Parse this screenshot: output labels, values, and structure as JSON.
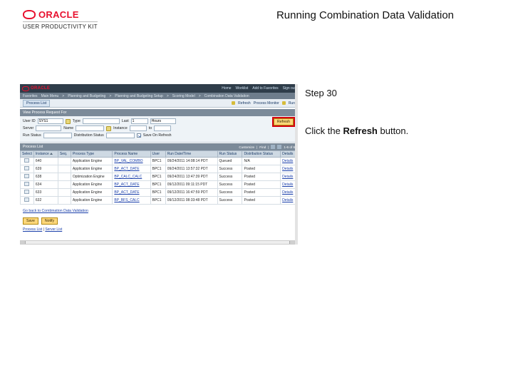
{
  "brand": {
    "name": "ORACLE",
    "product": "USER PRODUCTIVITY KIT"
  },
  "page_title": "Running Combination Data Validation",
  "step": {
    "label": "Step 30",
    "text_pre": "Click the ",
    "bold": "Refresh",
    "text_post": " button."
  },
  "app": {
    "menu": [
      "Home",
      "Worklist",
      "Add to Favorites",
      "Sign out"
    ],
    "crumbs": [
      "Favorites",
      "Main Menu",
      "Planning and Budgeting",
      "Planning and Budgeting Setup",
      "Scoring Model",
      "Combination Data Validation"
    ],
    "listhdr": {
      "tab": "Process List",
      "right": [
        "Refresh",
        "Process Monitor",
        "Run"
      ],
      "icon": "gear-icon"
    },
    "panel_title": "View Process Request For",
    "form": {
      "fields": {
        "user_id_lbl": "User ID",
        "user_id": "SYS1",
        "type_lbl": "Type",
        "type": "",
        "last_lbl": "Last",
        "last": "1",
        "last_unit": "Hours",
        "server_lbl": "Server",
        "server": "",
        "name_lbl": "Name",
        "name": "",
        "instance_lbl": "Instance",
        "instance_to": "to",
        "runstatus_lbl": "Run Status",
        "distrib_lbl": "Distribution Status",
        "savecb_lbl": "Save On Refresh"
      },
      "refresh_btn": "Refresh"
    },
    "table": {
      "cols": [
        "Select",
        "Instance",
        "Seq.",
        "Process Type",
        "Process Name",
        "User",
        "Run Date/Time",
        "Run Status",
        "Distribution Status",
        "Details"
      ],
      "rows": [
        {
          "inst": "640",
          "seq": "",
          "ptype": "Application Engine",
          "pname": "BP_VAL_COMBO",
          "user": "BPC1",
          "dt": "09/24/2011 14:08:14 PDT",
          "run": "Queued",
          "dist": "N/A",
          "det": "Details"
        },
        {
          "inst": "639",
          "seq": "",
          "ptype": "Application Engine",
          "pname": "BP_ACT_DATE",
          "user": "BPC1",
          "dt": "09/24/2011 13:57:32 PDT",
          "run": "Success",
          "dist": "Posted",
          "det": "Details"
        },
        {
          "inst": "638",
          "seq": "",
          "ptype": "Optimization Engine",
          "pname": "BP_CALC_CALC",
          "user": "BPC1",
          "dt": "09/24/2011 13:47:39 PDT",
          "run": "Success",
          "dist": "Posted",
          "det": "Details"
        },
        {
          "inst": "634",
          "seq": "",
          "ptype": "Application Engine",
          "pname": "BP_ACT_DATE",
          "user": "BPC1",
          "dt": "09/12/2011 09:11:15 PDT",
          "run": "Success",
          "dist": "Posted",
          "det": "Details"
        },
        {
          "inst": "633",
          "seq": "",
          "ptype": "Application Engine",
          "pname": "BP_ACT_DATE",
          "user": "BPC1",
          "dt": "09/12/2011 16:47:59 PDT",
          "run": "Success",
          "dist": "Posted",
          "det": "Details"
        },
        {
          "inst": "632",
          "seq": "",
          "ptype": "Application Engine",
          "pname": "BP_BFS_CALC",
          "user": "BPC1",
          "dt": "09/12/2011 08:33:48 PDT",
          "run": "Success",
          "dist": "Posted",
          "det": "Details"
        }
      ],
      "pager": "1-6 of 6"
    },
    "lower": {
      "link": "Go back to Combination Data Validation",
      "btns": [
        "Save",
        "Notify"
      ],
      "tabs": [
        "Process List",
        "Server List"
      ]
    }
  }
}
